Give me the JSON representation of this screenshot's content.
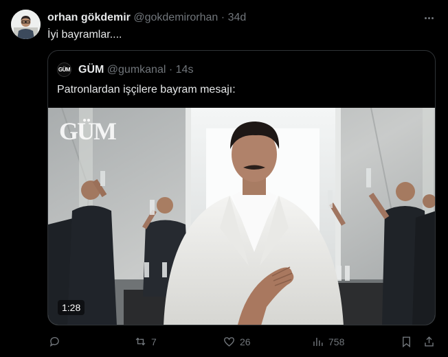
{
  "tweet": {
    "author_name": "orhan gökdemir",
    "author_handle": "@gokdemirorhan",
    "separator": "·",
    "time": "34d",
    "text": "İyi bayramlar...."
  },
  "quoted": {
    "logo_text": "GÜM",
    "author_name": "GÜM",
    "author_handle": "@gumkanal",
    "separator": "·",
    "time": "14s",
    "text": "Patronlardan işçilere bayram mesajı:",
    "video": {
      "watermark": "GÜM",
      "duration": "1:28"
    }
  },
  "actions": {
    "replies": "",
    "retweets": "7",
    "likes": "26",
    "views": "758"
  },
  "icons": {
    "more": "more-icon",
    "reply": "reply-icon",
    "retweet": "retweet-icon",
    "like": "heart-icon",
    "views": "views-icon",
    "bookmark": "bookmark-icon",
    "share": "share-icon"
  },
  "colors": {
    "background": "#000000",
    "text": "#e7e9ea",
    "secondary": "#71767b",
    "border": "#2f3336"
  }
}
